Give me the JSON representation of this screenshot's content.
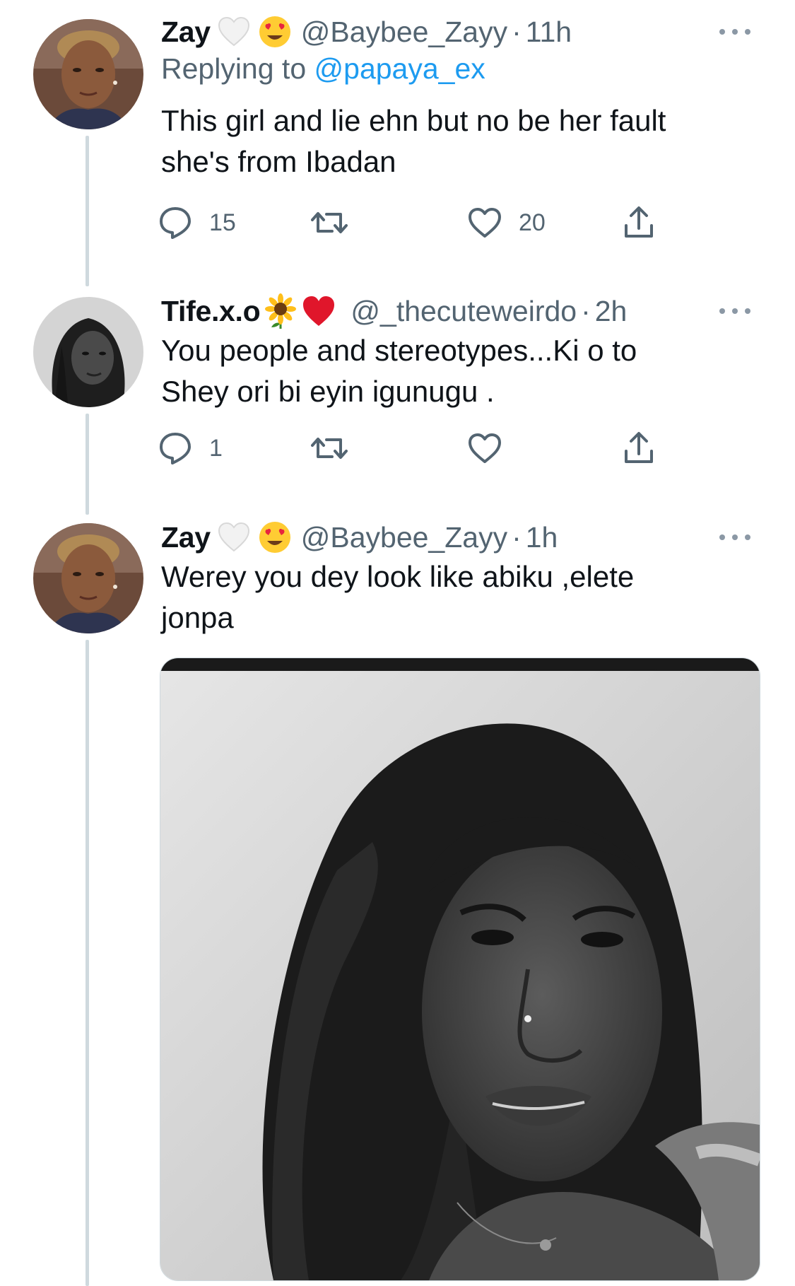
{
  "colors": {
    "text_primary": "#0f1419",
    "text_secondary": "#536471",
    "link": "#1d9bf0",
    "thread_line": "#cfd9de"
  },
  "tweets": [
    {
      "display_name": "Zay",
      "emojis": [
        "white-heart-icon",
        "heart-eyes-emoji-icon"
      ],
      "handle": "@Baybee_Zayy",
      "separator": "·",
      "time": "11h",
      "replying_to_label": "Replying to",
      "replying_to_handle": "@papaya_ex",
      "text": "This girl and lie ehn but no be her fault she's from Ibadan",
      "reply_count": "15",
      "retweet_count": "",
      "like_count": "20"
    },
    {
      "display_name": "Tife.x.o",
      "emojis": [
        "sunflower-icon",
        "red-heart-icon"
      ],
      "handle": "@_thecuteweirdo",
      "separator": "·",
      "time": "2h",
      "text": "You people and stereotypes...Ki o to Shey ori bi eyin igunugu .",
      "reply_count": "1",
      "retweet_count": "",
      "like_count": ""
    },
    {
      "display_name": "Zay",
      "emojis": [
        "white-heart-icon",
        "heart-eyes-emoji-icon"
      ],
      "handle": "@Baybee_Zayy",
      "separator": "·",
      "time": "1h",
      "text": "Werey you dey look like abiku ,elete jonpa",
      "media": "black-and-white-portrait-photo"
    }
  ]
}
